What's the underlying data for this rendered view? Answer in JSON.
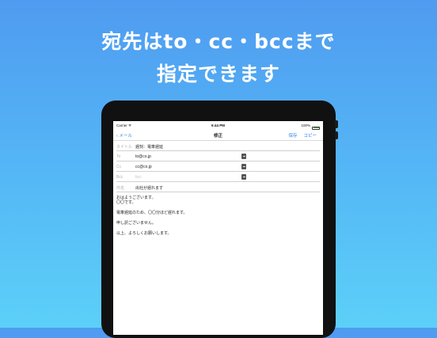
{
  "headline": {
    "line1": "宛先はto・cc・bccまで",
    "line2": "指定できます"
  },
  "status": {
    "carrier": "Carrier ᯤ",
    "time": "6:44 PM",
    "battery": "100%"
  },
  "nav": {
    "back": "‹ メール",
    "title": "修正",
    "save": "保存",
    "copy": "コピー"
  },
  "fields": [
    {
      "label": "タイトル",
      "value": "遅刻：電車遅延",
      "placeholder": false,
      "book": false
    },
    {
      "label": "To",
      "value": "to@co.jp",
      "placeholder": false,
      "book": true
    },
    {
      "label": "Cc",
      "value": "cc@co.jp",
      "placeholder": false,
      "book": true
    },
    {
      "label": "Bcc",
      "value": "bcc",
      "placeholder": true,
      "book": true
    },
    {
      "label": "件名",
      "value": "出社が遅れます",
      "placeholder": false,
      "book": false
    }
  ],
  "body": [
    "おはようございます。",
    "〇〇です。",
    "",
    "電車遅延のため、〇〇分ほど遅れます。",
    "",
    "申し訳ございません。",
    "",
    "以上、よろしくお願いします。"
  ],
  "colors": {
    "accent": "#2f7ff0",
    "battery": "#3bc04b"
  }
}
